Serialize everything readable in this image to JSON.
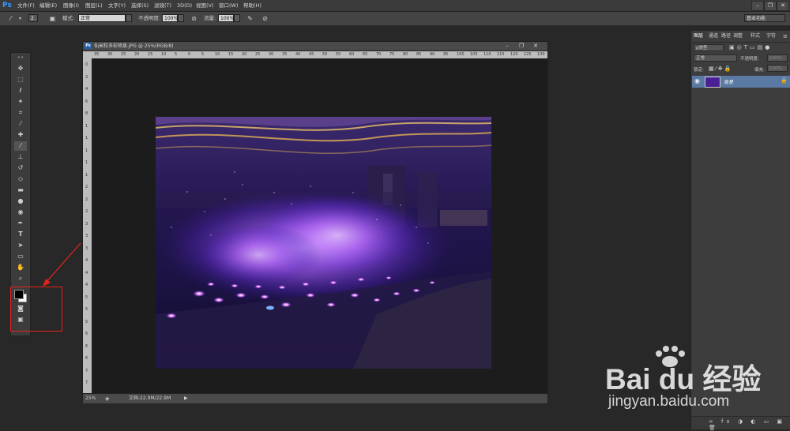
{
  "app": {
    "logo": "Ps"
  },
  "menubar": {
    "items": [
      "文件(F)",
      "编辑(E)",
      "图像(I)",
      "图层(L)",
      "文字(Y)",
      "选择(S)",
      "滤镜(T)",
      "3D(D)",
      "视图(V)",
      "窗口(W)",
      "帮助(H)"
    ],
    "minimize": "–",
    "restore": "❐",
    "close": "✕"
  },
  "options": {
    "brush_size": "2",
    "mode_label": "模式:",
    "mode_value": "正常",
    "opacity_label": "不透明度:",
    "opacity_value": "100%",
    "flow_label": "流量:",
    "flow_value": "100%",
    "workspace": "基本功能"
  },
  "document": {
    "title": "仙米粒多彩喷泉.JPG @ 25%(RGB/8)",
    "ps_badge": "Ps",
    "zoom": "25%",
    "doc_size": "文档:22.9M/22.9M",
    "ruler_top": [
      "35",
      "30",
      "25",
      "20",
      "15",
      "10",
      "5",
      "0",
      "5",
      "10",
      "15",
      "20",
      "25",
      "30",
      "35",
      "40",
      "45",
      "50",
      "55",
      "60",
      "65",
      "70",
      "75",
      "80",
      "85",
      "90",
      "95",
      "100",
      "105",
      "110",
      "115",
      "120",
      "125",
      "130"
    ],
    "ruler_left": [
      "0",
      "2",
      "4",
      "6",
      "8",
      "1",
      "1",
      "1",
      "1",
      "1",
      "2",
      "2",
      "2",
      "3",
      "3",
      "3",
      "4",
      "4",
      "4",
      "5",
      "5",
      "5",
      "6",
      "6",
      "6",
      "7",
      "7"
    ]
  },
  "panel": {
    "tabs": [
      "图层",
      "通道",
      "路径",
      "调整",
      "样式",
      "字符"
    ],
    "filter_kind": "ρ类型",
    "blend_mode": "正常",
    "opacity_label": "不透明度:",
    "opacity_value": "100%",
    "lock_label": "锁定:",
    "fill_label": "填充:",
    "fill_value": "100%",
    "layer_name": "背景"
  },
  "watermark": {
    "brand": "Bai du 经验",
    "url": "jingyan.baidu.com"
  },
  "colors": {
    "accent": "#3b9bff",
    "highlight": "#e5231b",
    "selected_layer": "#5a7aa3"
  },
  "icons": [
    "ps-logo-icon",
    "brush-icon",
    "brush-preset-icon",
    "airbrush-icon",
    "pressure-icon",
    "move-icon",
    "marquee-icon",
    "lasso-icon",
    "quick-select-icon",
    "crop-icon",
    "eyedropper-icon",
    "healing-icon",
    "brush-tool-icon",
    "stamp-icon",
    "history-brush-icon",
    "eraser-icon",
    "gradient-icon",
    "blur-icon",
    "dodge-icon",
    "pen-icon",
    "type-icon",
    "path-select-icon",
    "shape-icon",
    "hand-icon",
    "zoom-icon",
    "color-swatch-icon",
    "quick-mask-icon",
    "screen-mode-icon",
    "eye-icon",
    "lock-icon"
  ]
}
